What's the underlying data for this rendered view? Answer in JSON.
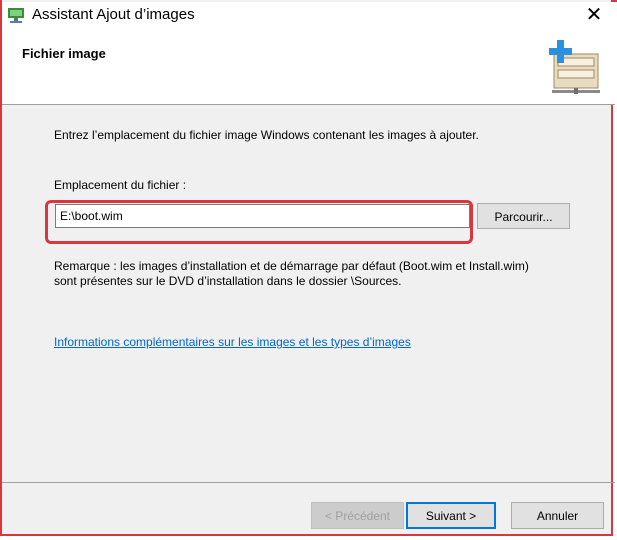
{
  "window": {
    "title": "Assistant Ajout d’images",
    "close_glyph": "✕"
  },
  "header": {
    "title": "Fichier image",
    "icon": "add-image-cabinet-icon"
  },
  "body": {
    "intro": "Entrez l’emplacement du fichier image Windows contenant les images à ajouter.",
    "location_label": "Emplacement du fichier :",
    "location_value": "E:\\boot.wim",
    "browse_label": "Parcourir...",
    "remark": "Remarque : les images d’installation et de démarrage par défaut (Boot.wim et Install.wim) sont présentes sur le DVD d’installation dans le dossier \\Sources.",
    "info_link": "Informations complémentaires sur les images et les types d’images"
  },
  "footer": {
    "prev_label": "< Précédent",
    "next_label": "Suivant >",
    "cancel_label": "Annuler"
  },
  "colors": {
    "highlight": "#d9363e",
    "link": "#0066cc",
    "focus": "#0078d7"
  }
}
